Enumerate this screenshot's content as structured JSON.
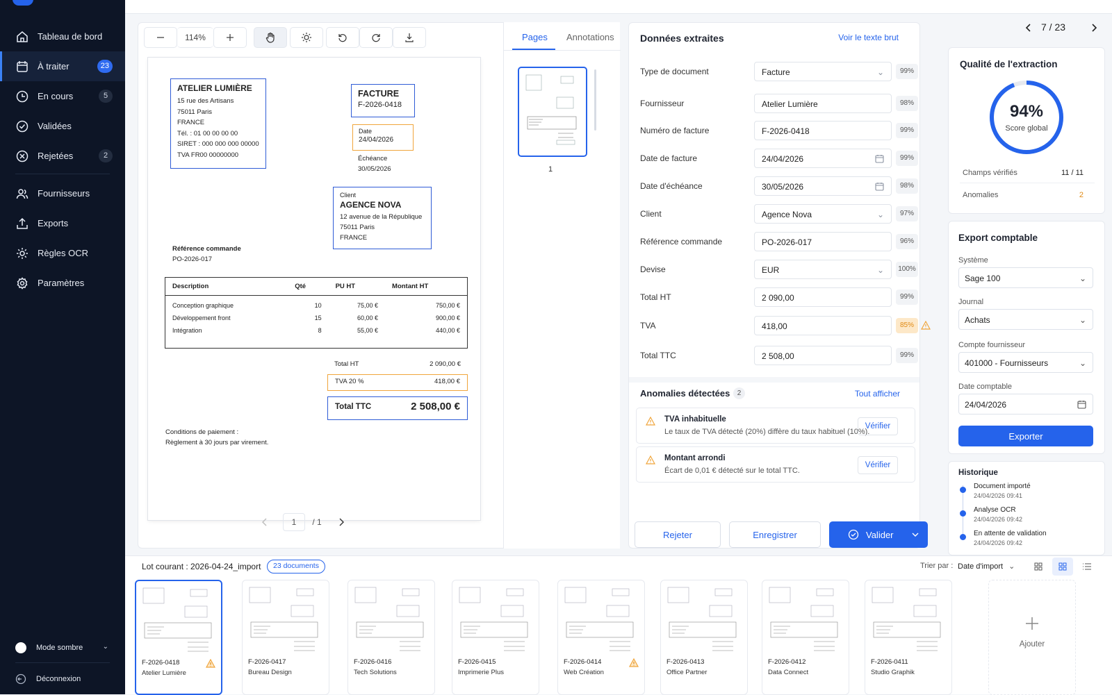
{
  "sidebar": {
    "items": [
      {
        "label": "Tableau de bord",
        "icon": "home-icon"
      },
      {
        "label": "À traiter",
        "icon": "inbox-icon",
        "badge": "23"
      },
      {
        "label": "En cours",
        "icon": "clock-icon",
        "badge": "5"
      },
      {
        "label": "Validées",
        "icon": "check-circle-icon"
      },
      {
        "label": "Rejetées",
        "icon": "x-circle-icon",
        "badge": "2"
      },
      {
        "label": "Fournisseurs",
        "icon": "users-icon"
      },
      {
        "label": "Exports",
        "icon": "upload-icon"
      },
      {
        "label": "Règles OCR",
        "icon": "gear-icon"
      },
      {
        "label": "Paramètres",
        "icon": "settings-icon"
      }
    ],
    "dark_mode": "Mode sombre",
    "logout": "Déconnexion"
  },
  "viewer": {
    "zoom": "114%",
    "page_current": "1",
    "page_total": "/ 1"
  },
  "invoice": {
    "supplier_name": "ATELIER LUMIÈRE",
    "supplier_lines": [
      "15 rue des Artisans",
      "75011 Paris",
      "FRANCE",
      "Tél. : 01 00 00 00 00",
      "SIRET : 000 000 000 00000",
      "TVA FR00 00000000"
    ],
    "doc_type": "FACTURE",
    "doc_number": "F-2026-0418",
    "date_label": "Date",
    "date_value": "24/04/2026",
    "due_label": "Échéance",
    "due_value": "30/05/2026",
    "client_label": "Client",
    "client_name": "AGENCE NOVA",
    "client_lines": [
      "12 avenue de la République",
      "75011 Paris",
      "FRANCE"
    ],
    "ref_label": "Référence commande",
    "ref_value": "PO-2026-017",
    "table_headers": [
      "Description",
      "Qté",
      "PU HT",
      "Montant HT"
    ],
    "table_rows": [
      [
        "Conception graphique",
        "10",
        "75,00 €",
        "750,00 €"
      ],
      [
        "Développement front",
        "15",
        "60,00 €",
        "900,00 €"
      ],
      [
        "Intégration",
        "8",
        "55,00 €",
        "440,00 €"
      ]
    ],
    "total_ht_label": "Total HT",
    "total_ht_value": "2 090,00 €",
    "tva_label": "TVA 20 %",
    "tva_value": "418,00 €",
    "ttc_label": "Total TTC",
    "ttc_value": "2 508,00 €",
    "conditions_1": "Conditions de paiement :",
    "conditions_2": "Règlement à 30 jours par virement."
  },
  "pages_panel": {
    "tab_pages": "Pages",
    "tab_annotations": "Annotations",
    "page_number": "1"
  },
  "extracted": {
    "title": "Données extraites",
    "raw_link": "Voir le texte brut",
    "fields": [
      {
        "label": "Type de document",
        "value": "Facture",
        "conf": "99%"
      },
      {
        "label": "Fournisseur",
        "value": "Atelier Lumière",
        "conf": "98%"
      },
      {
        "label": "Numéro de facture",
        "value": "F-2026-0418",
        "conf": "99%"
      },
      {
        "label": "Date de facture",
        "value": "24/04/2026",
        "conf": "99%"
      },
      {
        "label": "Date d'échéance",
        "value": "30/05/2026",
        "conf": "98%"
      },
      {
        "label": "Client",
        "value": "Agence Nova",
        "conf": "97%"
      },
      {
        "label": "Référence commande",
        "value": "PO-2026-017",
        "conf": "96%"
      },
      {
        "label": "Devise",
        "value": "EUR",
        "conf": "100%"
      },
      {
        "label": "Total HT",
        "value": "2 090,00",
        "conf": "99%"
      },
      {
        "label": "TVA",
        "value": "418,00",
        "conf": "85%"
      },
      {
        "label": "Total TTC",
        "value": "2 508,00",
        "conf": "99%"
      }
    ]
  },
  "anomalies": {
    "title": "Anomalies détectées",
    "count": "2",
    "show_all": "Tout afficher",
    "items": [
      {
        "title": "TVA inhabituelle",
        "desc": "Le taux de TVA détecté (20%) diffère du taux habituel (10%).",
        "action": "Vérifier"
      },
      {
        "title": "Montant arrondi",
        "desc": "Écart de 0,01 € détecté sur le total TTC.",
        "action": "Vérifier"
      }
    ]
  },
  "actions": {
    "reject": "Rejeter",
    "save": "Enregistrer",
    "validate": "Valider"
  },
  "navigation": {
    "position": "7 / 23"
  },
  "quality": {
    "title": "Qualité de l'extraction",
    "score": "94%",
    "score_value": 0.94,
    "score_label": "Score global",
    "checked_label": "Champs vérifiés",
    "checked_value": "11 / 11",
    "anomalies_label": "Anomalies",
    "anomalies_value": "2"
  },
  "export": {
    "title": "Export comptable",
    "system_label": "Système",
    "system_value": "Sage 100",
    "journal_label": "Journal",
    "journal_value": "Achats",
    "account_label": "Compte fournisseur",
    "account_value": "401000 - Fournisseurs",
    "date_label": "Date comptable",
    "date_value": "24/04/2026",
    "button": "Exporter"
  },
  "history": {
    "title": "Historique",
    "items": [
      {
        "label": "Document importé",
        "time": "24/04/2026 09:41"
      },
      {
        "label": "Analyse OCR",
        "time": "24/04/2026 09:42"
      },
      {
        "label": "En attente de validation",
        "time": "24/04/2026 09:42"
      }
    ]
  },
  "batch": {
    "title": "Lot courant : 2026-04-24_import",
    "count": "23 documents",
    "sort_label": "Trier par :",
    "sort_value": "Date d'import",
    "add_label": "Ajouter",
    "docs": [
      {
        "id": "F-2026-0418",
        "supplier": "Atelier Lumière",
        "warn": true
      },
      {
        "id": "F-2026-0417",
        "supplier": "Bureau Design",
        "warn": false
      },
      {
        "id": "F-2026-0416",
        "supplier": "Tech Solutions",
        "warn": false
      },
      {
        "id": "F-2026-0415",
        "supplier": "Imprimerie Plus",
        "warn": false
      },
      {
        "id": "F-2026-0414",
        "supplier": "Web Création",
        "warn": true
      },
      {
        "id": "F-2026-0413",
        "supplier": "Office Partner",
        "warn": false
      },
      {
        "id": "F-2026-0412",
        "supplier": "Data Connect",
        "warn": false
      },
      {
        "id": "F-2026-0411",
        "supplier": "Studio Graphik",
        "warn": false
      }
    ]
  },
  "colors": {
    "accent": "#2563eb",
    "sidebar": "#0d1526",
    "warning": "#f0a53b"
  }
}
